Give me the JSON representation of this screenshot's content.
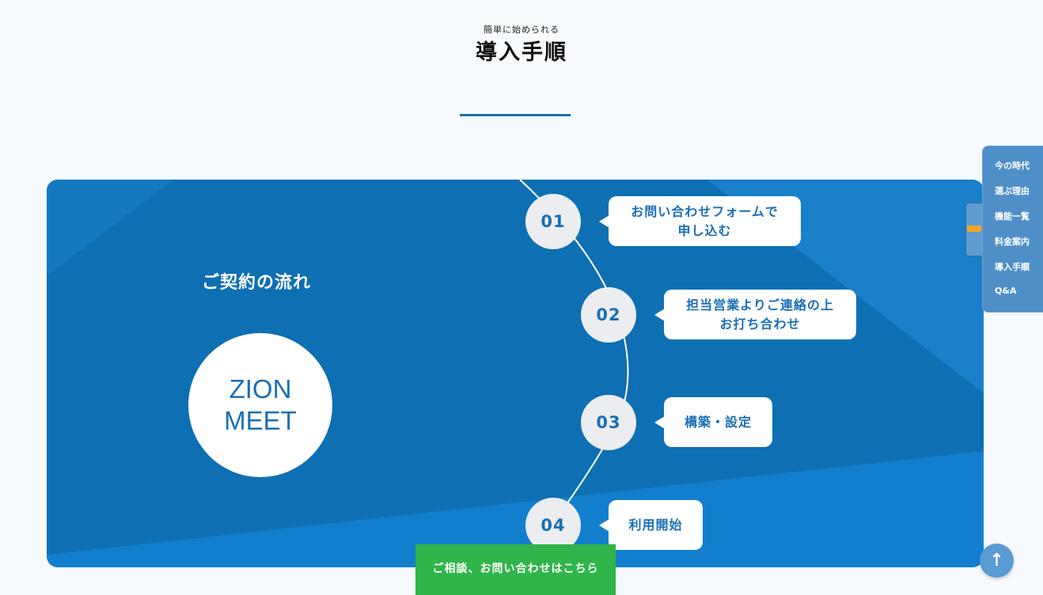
{
  "header": {
    "subtitle": "簡単に始められる",
    "title": "導入手順"
  },
  "flow": {
    "label": "ご契約の流れ",
    "logo_line1": "ZION",
    "logo_line2": "MEET",
    "steps": [
      {
        "number": "01",
        "text_line1": "お問い合わせフォームで",
        "text_line2": "申し込む"
      },
      {
        "number": "02",
        "text_line1": "担当営業よりご連絡の上",
        "text_line2": "お打ち合わせ"
      },
      {
        "number": "03",
        "text_line1": "構築・設定",
        "text_line2": ""
      },
      {
        "number": "04",
        "text_line1": "利用開始",
        "text_line2": ""
      }
    ]
  },
  "side_nav": {
    "items": [
      "今の時代",
      "選ぶ理由",
      "機能一覧",
      "料金案内",
      "導入手順",
      "Q&A"
    ]
  },
  "contact_button": {
    "label": "ご相談、お問い合わせはこちら"
  },
  "to_top": {
    "icon": "arrow-up-icon",
    "glyph": "↑"
  },
  "colors": {
    "panel_blue": "#0e6fb2",
    "accent_blue": "#1a6fb4",
    "contact_green": "#2fb54a",
    "nav_blue": "#4f8fc8"
  }
}
